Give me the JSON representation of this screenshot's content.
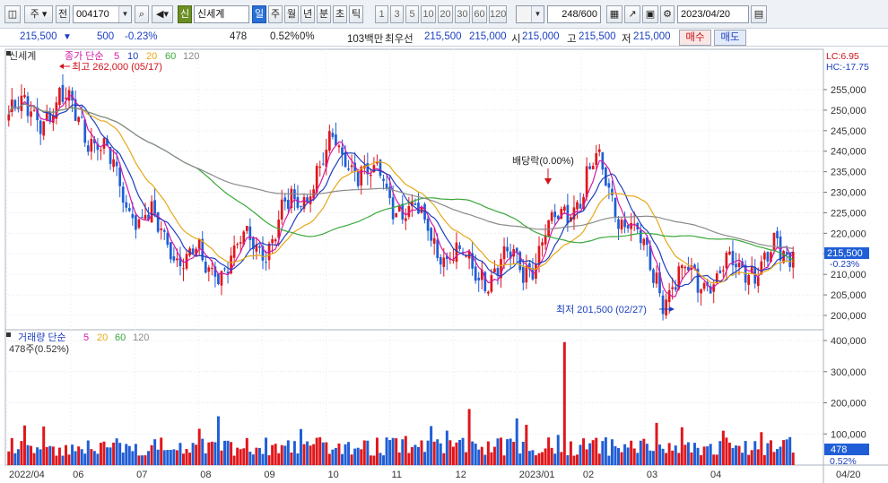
{
  "toolbar": {
    "market_label": "주",
    "prefix_label": "전",
    "code": "004170",
    "name_badge": "신",
    "stock_name": "신세계",
    "periods": [
      "일",
      "주",
      "월",
      "년",
      "분",
      "초",
      "틱"
    ],
    "active_period": "일",
    "intervals": [
      "1",
      "3",
      "5",
      "10",
      "20",
      "30",
      "60",
      "120"
    ],
    "count": "248",
    "count_total": "/600",
    "date": "2023/04/20"
  },
  "quote": {
    "price": "215,500",
    "change": "500",
    "change_pct": "-0.23%",
    "volume": "478",
    "volume_pct": "0.52%",
    "zero_pct": "0%",
    "amount": "103백만",
    "best_label": "최우선",
    "best_ask": "215,500",
    "best_bid": "215,000",
    "open_label": "시",
    "open": "215,000",
    "high_label": "고",
    "high": "215,500",
    "low_label": "저",
    "low": "215,000",
    "buy_label": "매수",
    "sell_label": "매도"
  },
  "price_panel": {
    "name": "신세계",
    "legend_title": "종가 단순",
    "ma_periods": [
      "5",
      "10",
      "20",
      "60",
      "120"
    ],
    "lc_label": "LC:6.95",
    "hc_label": "HC:-17.75",
    "high_note": "최고 262,000 (05/17)",
    "low_note": "최저 201,500 (02/27)",
    "dividend_note": "배당락(0.00%)",
    "last_price_tag": "215,500",
    "last_change_tag": "-0.23%"
  },
  "volume_panel": {
    "title": "거래량 단순",
    "ma_periods": [
      "5",
      "20",
      "60",
      "120"
    ],
    "current": "478주(0.52%)",
    "last_tag": "478",
    "last_pct_tag": "0.52%"
  },
  "chart_data": {
    "type": "candlestick",
    "price_axis": {
      "ticks": [
        "255,000",
        "250,000",
        "245,000",
        "240,000",
        "235,000",
        "230,000",
        "225,000",
        "220,000",
        "215,000",
        "210,000",
        "205,000",
        "200,000"
      ],
      "ylim": [
        199000,
        260000
      ]
    },
    "volume_axis": {
      "ticks": [
        "400,000",
        "300,000",
        "200,000",
        "100,000"
      ],
      "ylim": [
        0,
        440000
      ]
    },
    "x_labels": [
      "2022/04",
      "06",
      "07",
      "08",
      "09",
      "10",
      "11",
      "12",
      "2023/01",
      "02",
      "03",
      "04",
      "04/20"
    ],
    "monthly_close": [
      {
        "month": "2022/04",
        "close": 249000
      },
      {
        "month": "2022/05",
        "close": 251000
      },
      {
        "month": "2022/06",
        "close": 224000
      },
      {
        "month": "2022/07",
        "close": 211000
      },
      {
        "month": "2022/08",
        "close": 219000
      },
      {
        "month": "2022/09",
        "close": 241000
      },
      {
        "month": "2022/10",
        "close": 228000
      },
      {
        "month": "2022/11",
        "close": 211000
      },
      {
        "month": "2022/12",
        "close": 213000
      },
      {
        "month": "2023/01",
        "close": 236000
      },
      {
        "month": "2023/02",
        "close": 207000
      },
      {
        "month": "2023/03",
        "close": 211000
      },
      {
        "month": "2023/04",
        "close": 215500
      }
    ],
    "high": {
      "value": 262000,
      "date": "05/17"
    },
    "low": {
      "value": 201500,
      "date": "02/27"
    },
    "last": 215500,
    "ma_colors": {
      "ma5": "#d21aa8",
      "ma10": "#1f3fbf",
      "ma20": "#e6a817",
      "ma60": "#3aa83a",
      "ma120": "#8a8a8a"
    },
    "up_color": "#e0161b",
    "down_color": "#1f5ed6"
  }
}
